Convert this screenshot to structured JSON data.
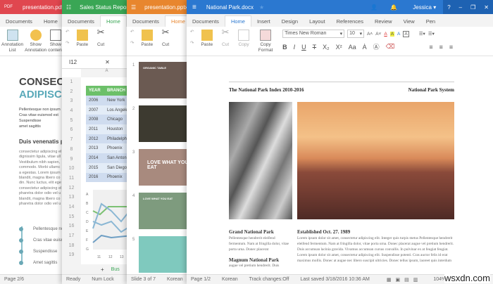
{
  "pdf": {
    "title": "presentation.pdf",
    "logo": "PDF",
    "color": "#e0474f",
    "tabs": [
      "Documents",
      "Home"
    ],
    "ribbon": [
      "Annotation List",
      "Show Annotation",
      "Show content"
    ],
    "heading1": "CONSECT",
    "heading2": "ADIPISCI",
    "para1": [
      "Pellentesque non ipsum",
      "Cras vitae euismod est",
      "Suspendisse",
      "amet sagittis"
    ],
    "subheading": "Duis venenatis p",
    "para2": [
      "consectetur adipiscing el",
      "dignissim ligula, vitae ull",
      "Vestibulum nibh sapien,",
      "commodo. Morbi ullamc",
      "a egestas. Lorem ipsum",
      "blandit, magna libero co",
      "din. Nunc luctus, elit ege",
      "consectetur adipiscing el",
      "pharetra dolor odio vel u",
      "blandit, magna libero co",
      "pharetra dolor odio vel u"
    ],
    "bullets": [
      "Pellentesque no",
      "Cras vitae euism",
      "Suspendisse",
      "Amet sagittis"
    ],
    "status": "Page 2/6"
  },
  "sheet": {
    "title": "Sales Status Report",
    "color": "#3aa655",
    "tabs": [
      "Documents",
      "Home"
    ],
    "ribbon": [
      "Paste",
      "Cut"
    ],
    "cell": "I12",
    "col": "A",
    "rows": [
      "1",
      "2",
      "3",
      "4",
      "5",
      "6",
      "7",
      "8",
      "9",
      "10",
      "11",
      "12",
      "13",
      "14",
      "15",
      "16",
      "17",
      "18",
      "19"
    ],
    "headers": [
      "YEAR",
      "BRANCH"
    ],
    "data": [
      [
        "2006",
        "New York"
      ],
      [
        "2007",
        "Los Angeles"
      ],
      [
        "2008",
        "Chicago"
      ],
      [
        "2011",
        "Houston"
      ],
      [
        "2012",
        "Philadelphia"
      ],
      [
        "2013",
        "Phoenix"
      ],
      [
        "2014",
        "San Antonio"
      ],
      [
        "2015",
        "San Diego"
      ],
      [
        "2016",
        "Phoenix"
      ]
    ],
    "chart_y": [
      "A",
      "B",
      "C",
      "D",
      "E",
      "F",
      "G"
    ],
    "chart_x": [
      "11",
      "12",
      "13"
    ],
    "sheet_tab": "Bus",
    "add": "+",
    "status": [
      "Ready",
      "Num Lock"
    ]
  },
  "pptx": {
    "title": "presentation.pptx",
    "color": "#e8862e",
    "tabs": [
      "Documents",
      "Home"
    ],
    "ribbon": [
      "Paste",
      "Cut"
    ],
    "slides": [
      {
        "n": "1",
        "text": "ORGANIC TABLE"
      },
      {
        "n": "2",
        "text": ""
      },
      {
        "n": "3",
        "text": "LOVE WHAT YOU EAT"
      },
      {
        "n": "4",
        "text": "LOVE WHAT YOU EAT"
      },
      {
        "n": "5",
        "text": ""
      }
    ],
    "status": [
      "Slide 3 of 7",
      "Korean"
    ]
  },
  "word": {
    "title": "National Park.docx",
    "color": "#2b78d0",
    "user": "Jessica",
    "tabs": [
      "Documents",
      "Home",
      "Insert",
      "Design",
      "Layout",
      "References",
      "Review",
      "View",
      "Pen"
    ],
    "ribbon": [
      "Paste",
      "Cut",
      "Copy",
      "Copy Format"
    ],
    "font": "Times New Roman",
    "size": "10",
    "header_left": "The National Park Index 2010-2016",
    "header_right": "National Park System",
    "col1_title": "Grand National Park",
    "col1_text": "Pellentesque hendrerit eleifend fermentum. Nam at fringilla dolor, vitae porta urna. Donec placerat",
    "col1_title2": "Magnum National Park",
    "col1_text2": "augue vel pretium hendrerit. Duis",
    "col2_title": "Established Oct. 27. 1989",
    "col2_text": "Lorem ipsum dolor sit amet, consectetur adipiscing elit. Integer quis turpis metus Pellentesque hendrerit eleifend fermentum. Nam at fringilla dolor, vitae porta urna. Donec placerat augue vel pretium hendrerit. Duis accumsan lacinia gravida. Vivamus accumsan cursus convallis. In pulvinar ex at feugiat feugiat. Lorem ipsum dolor sit amet, consectetur adipiscing elit. Suspendisse potenti. Cras auctor felis id erat maximus mollis. Donec at augue nec libero suscipit ultricies. Donec tellus ipsum, laoreet quis interdum",
    "status": [
      "Page 1/2",
      "Korean",
      "Track changes:Off",
      "Last saved 3/18/2016 10:36 AM"
    ],
    "zoom": "104%"
  },
  "watermark": "wsxdn.com"
}
